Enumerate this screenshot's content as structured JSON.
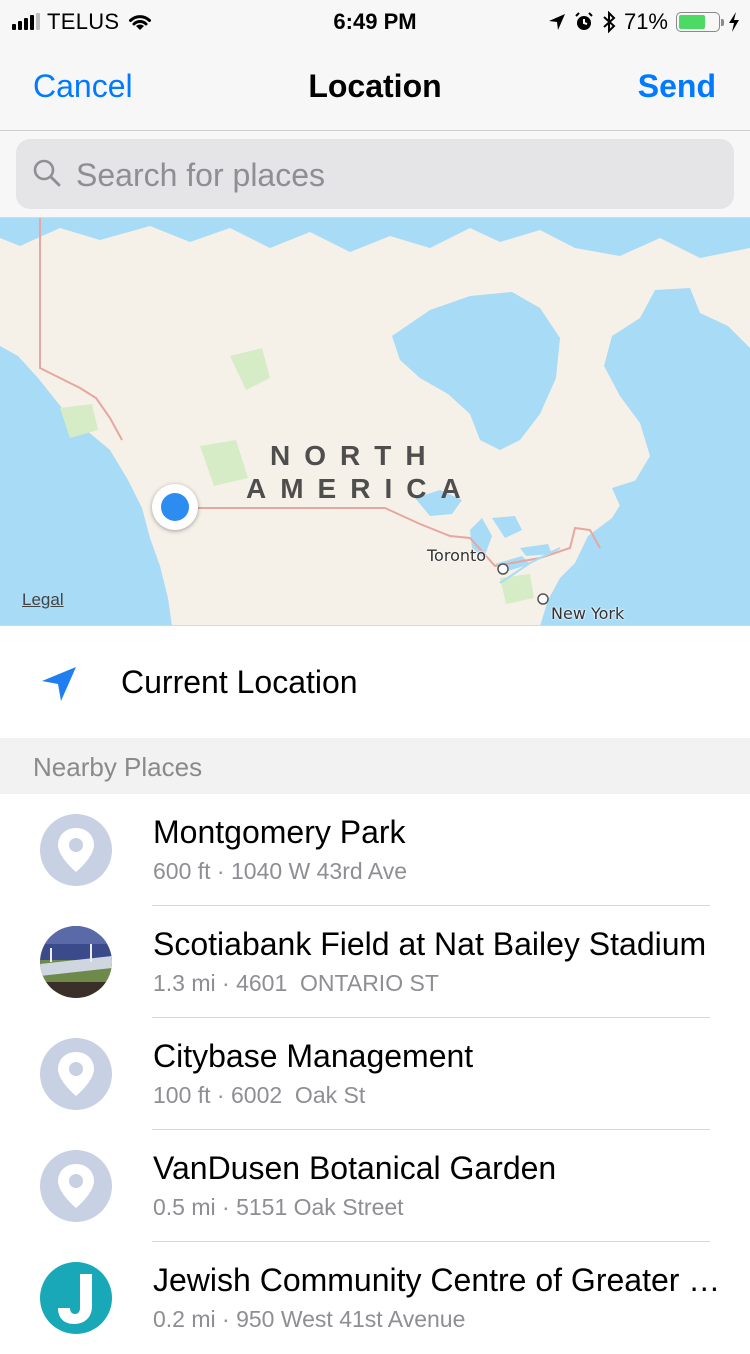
{
  "status_bar": {
    "carrier": "TELUS",
    "time": "6:49 PM",
    "battery_percent": "71%",
    "battery_level": 0.71,
    "icons": [
      "signal-icon",
      "wifi-icon",
      "location-arrow-icon",
      "alarm-icon",
      "bluetooth-icon",
      "battery-icon",
      "charging-icon"
    ]
  },
  "nav": {
    "cancel_label": "Cancel",
    "title": "Location",
    "send_label": "Send"
  },
  "search": {
    "placeholder": "Search for places"
  },
  "map": {
    "region_label_line1": "NORTH",
    "region_label_line2": "AMERICA",
    "cities": [
      "Toronto",
      "New York"
    ],
    "legal_label": "Legal"
  },
  "current_location": {
    "label": "Current Location"
  },
  "nearby": {
    "header": "Nearby Places",
    "places": [
      {
        "name": "Montgomery Park",
        "detail": "600 ft · 1040 W 43rd Ave",
        "avatar": "pin-icon"
      },
      {
        "name": "Scotiabank Field at Nat Bailey Stadium",
        "detail": "1.3 mi · 4601  ONTARIO ST",
        "avatar": "stadium-photo"
      },
      {
        "name": "Citybase Management",
        "detail": "100 ft · 6002  Oak St",
        "avatar": "pin-icon"
      },
      {
        "name": "VanDusen Botanical Garden",
        "detail": "0.5 mi · 5151 Oak Street",
        "avatar": "pin-icon"
      },
      {
        "name": "Jewish Community Centre of Greater Vancouver",
        "detail": "0.2 mi · 950 West 41st Avenue",
        "avatar": "jcc-logo"
      }
    ]
  },
  "colors": {
    "accent": "#007aff",
    "map_water": "#a8dbf5",
    "map_land": "#f5f1e8",
    "user_dot": "#2d8cf0",
    "pin_avatar": "#c8d0e4",
    "jcc_logo": "#19a8b8"
  }
}
